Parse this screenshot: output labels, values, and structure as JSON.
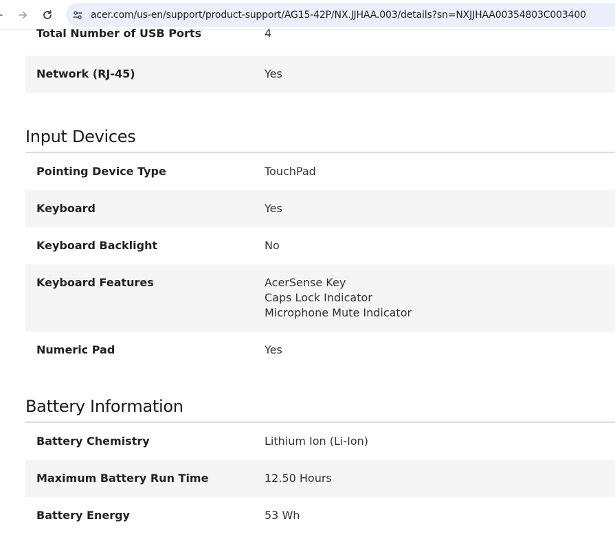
{
  "browser": {
    "url": "acer.com/us-en/support/product-support/AG15-42P/NX.JJHAA.003/details?sn=NXJJHAA00354803C003400"
  },
  "sections": [
    {
      "rows": [
        {
          "label": "Total Number of USB Ports",
          "value": "4"
        },
        {
          "label": "Network (RJ-45)",
          "value": "Yes"
        }
      ]
    },
    {
      "title": "Input Devices",
      "rows": [
        {
          "label": "Pointing Device Type",
          "value": "TouchPad"
        },
        {
          "label": "Keyboard",
          "value": "Yes"
        },
        {
          "label": "Keyboard Backlight",
          "value": "No"
        },
        {
          "label": "Keyboard Features",
          "values": [
            "AcerSense Key",
            "Caps Lock Indicator",
            "Microphone Mute Indicator"
          ]
        },
        {
          "label": "Numeric Pad",
          "value": "Yes"
        }
      ]
    },
    {
      "title": "Battery Information",
      "rows": [
        {
          "label": "Battery Chemistry",
          "value": "Lithium Ion (Li-Ion)"
        },
        {
          "label": "Maximum Battery Run Time",
          "value": "12.50 Hours"
        },
        {
          "label": "Battery Energy",
          "value": "53 Wh"
        }
      ]
    }
  ]
}
